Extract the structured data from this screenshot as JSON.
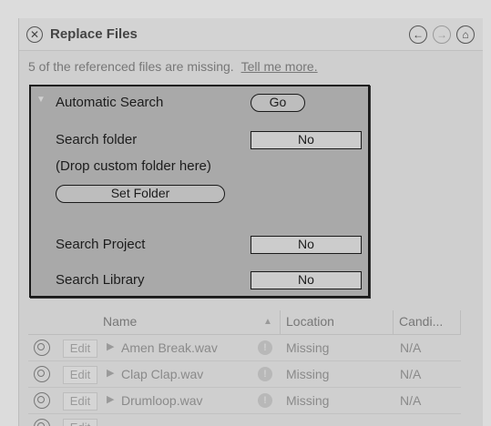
{
  "window": {
    "title": "Replace Files"
  },
  "info": {
    "message": "5 of the referenced files are missing.",
    "link": "Tell me more."
  },
  "table": {
    "headers": {
      "name": "Name",
      "location": "Location",
      "candidates": "Candi..."
    },
    "edit_label": "Edit",
    "rows": [
      {
        "name": "Amen Break.wav",
        "location": "Missing",
        "candidates": "N/A"
      },
      {
        "name": "Clap Clap.wav",
        "location": "Missing",
        "candidates": "N/A"
      },
      {
        "name": "Drumloop.wav",
        "location": "Missing",
        "candidates": "N/A"
      }
    ]
  },
  "auto_search": {
    "title": "Automatic Search",
    "go_label": "Go",
    "search_folder_label": "Search folder",
    "search_folder_value": "No",
    "drop_hint": "(Drop custom folder here)",
    "set_folder_label": "Set Folder",
    "search_project_label": "Search Project",
    "search_project_value": "No",
    "search_library_label": "Search Library",
    "search_library_value": "No"
  }
}
